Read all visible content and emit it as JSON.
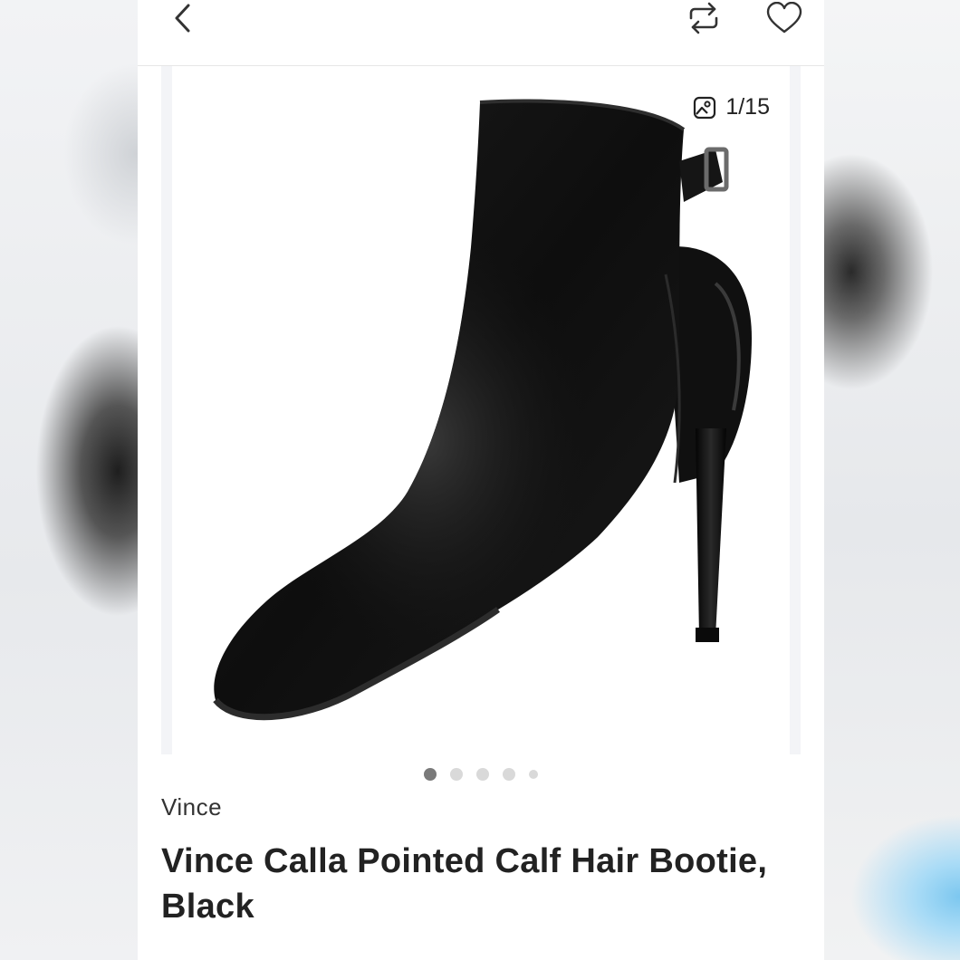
{
  "header": {
    "back_icon": "chevron-left-icon",
    "share_icon": "repost-icon",
    "like_icon": "heart-icon"
  },
  "gallery": {
    "counter_icon": "image-gallery-icon",
    "counter": "1/15",
    "dots_count": 5,
    "active_dot": 1
  },
  "product": {
    "brand": "Vince",
    "title": "Vince Calla Pointed Calf Hair Bootie, Black"
  }
}
